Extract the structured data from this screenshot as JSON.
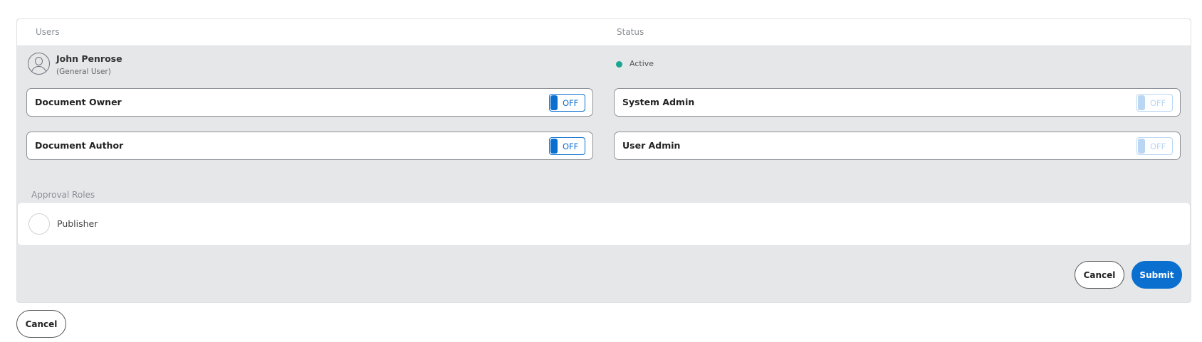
{
  "table": {
    "headers": {
      "users": "Users",
      "status": "Status"
    }
  },
  "user": {
    "name": "John Penrose",
    "role": "(General User)",
    "status": "Active",
    "status_color": "#1aa690"
  },
  "roles": [
    {
      "label": "Document Owner",
      "toggle": "OFF",
      "enabled": true
    },
    {
      "label": "System Admin",
      "toggle": "OFF",
      "enabled": false
    },
    {
      "label": "Document Author",
      "toggle": "OFF",
      "enabled": true
    },
    {
      "label": "User Admin",
      "toggle": "OFF",
      "enabled": false
    }
  ],
  "approval": {
    "title": "Approval Roles",
    "options": [
      {
        "label": "Publisher",
        "selected": false
      }
    ]
  },
  "actions": {
    "cancel": "Cancel",
    "submit": "Submit",
    "outer_cancel": "Cancel"
  },
  "colors": {
    "accent": "#0b6fd0",
    "panel_bg": "#e6e7e9"
  }
}
